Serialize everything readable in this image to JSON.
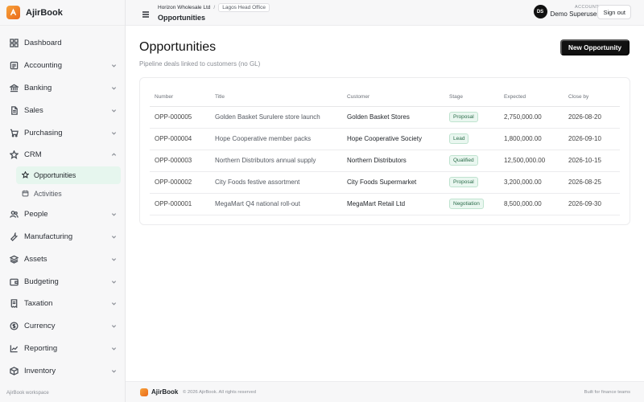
{
  "app": {
    "name": "AjirBook",
    "workspace_label": "AjirBook workspace"
  },
  "sidebar": {
    "items": [
      {
        "label": "Dashboard",
        "icon": "grid-icon",
        "expandable": false
      },
      {
        "label": "Accounting",
        "icon": "ledger-icon",
        "expandable": true
      },
      {
        "label": "Banking",
        "icon": "bank-icon",
        "expandable": true
      },
      {
        "label": "Sales",
        "icon": "document-icon",
        "expandable": true
      },
      {
        "label": "Purchasing",
        "icon": "cart-icon",
        "expandable": true
      },
      {
        "label": "CRM",
        "icon": "star-icon",
        "expandable": true,
        "expanded": true
      },
      {
        "label": "People",
        "icon": "people-icon",
        "expandable": true
      },
      {
        "label": "Manufacturing",
        "icon": "wrench-icon",
        "expandable": true
      },
      {
        "label": "Assets",
        "icon": "stack-icon",
        "expandable": true
      },
      {
        "label": "Budgeting",
        "icon": "wallet-icon",
        "expandable": true
      },
      {
        "label": "Taxation",
        "icon": "receipt-icon",
        "expandable": true
      },
      {
        "label": "Currency",
        "icon": "coin-icon",
        "expandable": true
      },
      {
        "label": "Reporting",
        "icon": "chart-line-icon",
        "expandable": true
      },
      {
        "label": "Inventory",
        "icon": "box-icon",
        "expandable": true
      }
    ],
    "crm_sub": [
      {
        "label": "Opportunities",
        "icon": "star-icon",
        "active": true
      },
      {
        "label": "Activities",
        "icon": "calendar-icon",
        "active": false
      }
    ]
  },
  "topbar": {
    "company": "Horizon Wholesale Ltd",
    "separator": "/",
    "branch": "Lagos Head Office",
    "page": "Opportunities",
    "account_kicker": "ACCOUNT",
    "account_name": "Demo Superuser",
    "avatar_initials": "DS",
    "signout_label": "Sign out"
  },
  "main": {
    "title": "Opportunities",
    "subtitle": "Pipeline deals linked to customers (no GL)",
    "new_button": "New Opportunity",
    "columns": [
      "Number",
      "Title",
      "Customer",
      "Stage",
      "Expected",
      "Close by"
    ],
    "rows": [
      {
        "number": "OPP-000005",
        "title": "Golden Basket Surulere store launch",
        "customer": "Golden Basket Stores",
        "stage": "Proposal",
        "expected": "2,750,000.00",
        "close_by": "2026-08-20"
      },
      {
        "number": "OPP-000004",
        "title": "Hope Cooperative member packs",
        "customer": "Hope Cooperative Society",
        "stage": "Lead",
        "expected": "1,800,000.00",
        "close_by": "2026-09-10"
      },
      {
        "number": "OPP-000003",
        "title": "Northern Distributors annual supply",
        "customer": "Northern Distributors",
        "stage": "Qualified",
        "expected": "12,500,000.00",
        "close_by": "2026-10-15"
      },
      {
        "number": "OPP-000002",
        "title": "City Foods festive assortment",
        "customer": "City Foods Supermarket",
        "stage": "Proposal",
        "expected": "3,200,000.00",
        "close_by": "2026-08-25"
      },
      {
        "number": "OPP-000001",
        "title": "MegaMart Q4 national roll-out",
        "customer": "MegaMart Retail Ltd",
        "stage": "Negotiation",
        "expected": "8,500,000.00",
        "close_by": "2026-09-30"
      }
    ]
  },
  "footer": {
    "brand": "AjirBook",
    "copyright": "© 2026 AjirBook. All rights reserved",
    "tagline": "Built for finance teams"
  },
  "colors": {
    "accent": "#ea6a1a",
    "badge_bg": "#eaf7f0",
    "badge_text": "#2a6b49",
    "primary_button": "#111111",
    "active_nav": "#e6f6ee"
  }
}
